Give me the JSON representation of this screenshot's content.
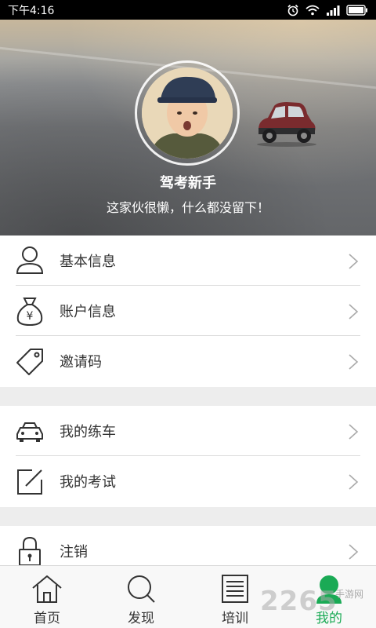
{
  "status_bar": {
    "time": "下午4:16"
  },
  "profile": {
    "nickname": "驾考新手",
    "signature": "这家伙很懒，什么都没留下！"
  },
  "menu": {
    "group1": [
      {
        "label": "基本信息",
        "icon": "person-icon"
      },
      {
        "label": "账户信息",
        "icon": "money-bag-icon"
      },
      {
        "label": "邀请码",
        "icon": "tag-icon"
      }
    ],
    "group2": [
      {
        "label": "我的练车",
        "icon": "car-icon"
      },
      {
        "label": "我的考试",
        "icon": "edit-icon"
      }
    ],
    "group3": [
      {
        "label": "注销",
        "icon": "lock-icon"
      }
    ]
  },
  "tabs": [
    {
      "label": "首页",
      "icon": "home-icon",
      "active": false
    },
    {
      "label": "发现",
      "icon": "search-icon",
      "active": false
    },
    {
      "label": "培训",
      "icon": "document-icon",
      "active": false
    },
    {
      "label": "我的",
      "icon": "profile-icon",
      "active": true
    }
  ],
  "colors": {
    "accent": "#1aaa55",
    "background": "#ededed"
  },
  "watermark": {
    "text": "2265",
    "subtext": "手游网"
  }
}
